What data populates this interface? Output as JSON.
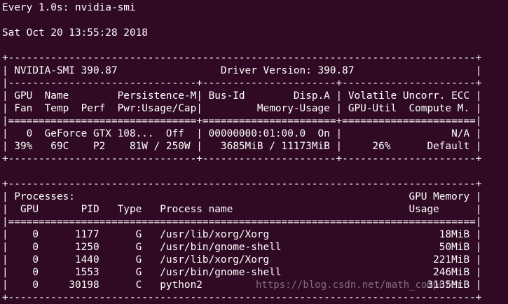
{
  "header": {
    "command_line": "Every 1.0s: nvidia-smi",
    "timestamp": "Sat Oct 20 13:55:28 2018"
  },
  "gpu_table": {
    "border_top": "+-----------------------------------------------------------------------------+",
    "version_row": "| NVIDIA-SMI 390.87                 Driver Version: 390.87                    |",
    "separator": "|-------------------------------+----------------------+----------------------+",
    "header_row_1": "| GPU  Name        Persistence-M| Bus-Id        Disp.A | Volatile Uncorr. ECC |",
    "header_row_2": "| Fan  Temp  Perf  Pwr:Usage/Cap|         Memory-Usage | GPU-Util  Compute M. |",
    "double_separator": "|===============================+======================+======================|",
    "gpu_row_1": "|   0  GeForce GTX 108...  Off  | 00000000:01:00.0  On |                  N/A |",
    "gpu_row_2": "| 39%   69C    P2    81W / 250W |   3685MiB / 11173MiB |     26%      Default |",
    "border_bottom": "+-------------------------------+----------------------+----------------------+"
  },
  "process_table": {
    "border_top": "+-----------------------------------------------------------------------------+",
    "title_row": "| Processes:                                                       GPU Memory |",
    "header_row": "|  GPU       PID   Type   Process name                             Usage      |",
    "double_separator": "|=============================================================================|",
    "rows": [
      "|    0      1177      G   /usr/lib/xorg/Xorg                            18MiB |",
      "|    0      1250      G   /usr/bin/gnome-shell                          50MiB |",
      "|    0      1440      G   /usr/lib/xorg/Xorg                           221MiB |",
      "|    0      1553      G   /usr/bin/gnome-shell                         246MiB |",
      "|    0     30198      C   python2                                     3135MiB |"
    ],
    "border_bottom": "+-----------------------------------------------------------------------------+"
  },
  "watermark": "https://blog.csdn.net/math_computer"
}
